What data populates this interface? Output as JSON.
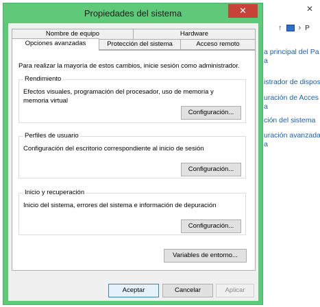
{
  "dialog": {
    "title": "Propiedades del sistema",
    "close_label": "✕"
  },
  "tabs": {
    "row1": [
      {
        "label": "Nombre de equipo"
      },
      {
        "label": "Hardware"
      }
    ],
    "row2": [
      {
        "label": "Opciones avanzadas",
        "active": true
      },
      {
        "label": "Protección del sistema"
      },
      {
        "label": "Acceso remoto"
      }
    ]
  },
  "panel": {
    "intro": "Para realizar la mayoría de estos cambios, inicie sesión como administrador.",
    "groups": [
      {
        "title": "Rendimiento",
        "desc": "Efectos visuales, programación del procesador, uso de memoria y memoria virtual",
        "button": "Configuración..."
      },
      {
        "title": "Perfiles de usuario",
        "desc": "Configuración del escritorio correspondiente al inicio de sesión",
        "button": "Configuración..."
      },
      {
        "title": "Inicio y recuperación",
        "desc": "Inicio del sistema, errores del sistema e información de depuración",
        "button": "Configuración..."
      }
    ],
    "env_button": "Variables de entorno..."
  },
  "footer": {
    "ok": "Aceptar",
    "cancel": "Cancelar",
    "apply": "Aplicar"
  },
  "background": {
    "address": "P",
    "links": [
      "a principal del Pa",
      "istrador de dispos",
      "uración de Acces",
      "ción del sistema",
      "uración avanzada"
    ],
    "link_extra": "a"
  }
}
